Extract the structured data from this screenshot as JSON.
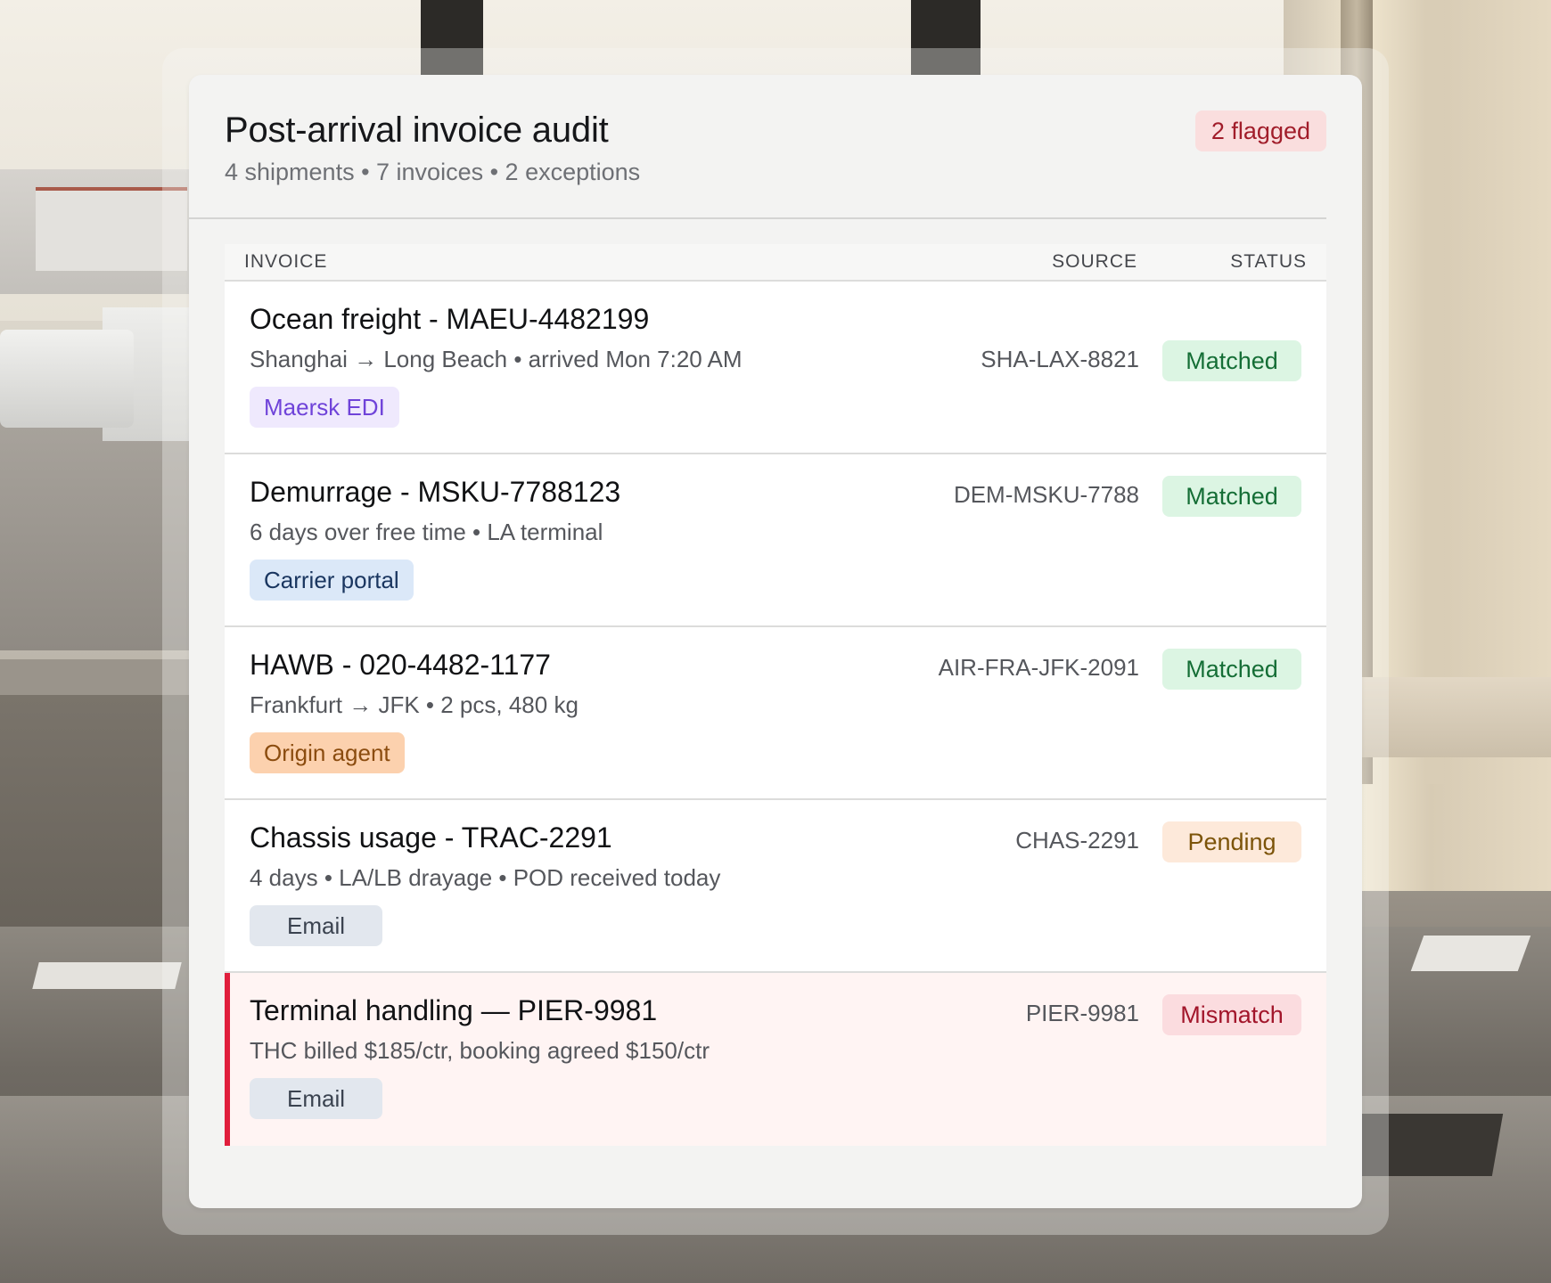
{
  "colors": {
    "accent_flag": "#e01e3c",
    "matched": "#156e36",
    "pending": "#7c5409",
    "mismatch": "#a2162b"
  },
  "audit": {
    "title": "Post-arrival invoice audit",
    "subtitle": "4 shipments • 7 invoices • 2 exceptions",
    "flag_badge": "2 flagged"
  },
  "table": {
    "headers": {
      "invoice": "INVOICE",
      "source": "SOURCE",
      "status": "STATUS"
    },
    "rows": [
      {
        "title": "Ocean freight - MAEU-4482199",
        "detail": "Shanghai → Long Beach • arrived Mon 7:20 AM",
        "chip": "Maersk EDI",
        "source": "SHA-LAX-8821",
        "status": "Matched"
      },
      {
        "title": "Demurrage - MSKU-7788123",
        "detail": "6 days over free time • LA terminal",
        "chip": "Carrier portal",
        "source": "DEM-MSKU-7788",
        "status": "Matched"
      },
      {
        "title": "HAWB - 020-4482-1177",
        "detail": "Frankfurt → JFK • 2 pcs, 480 kg",
        "chip": "Origin agent",
        "source": "AIR-FRA-JFK-2091",
        "status": "Matched"
      },
      {
        "title": "Chassis usage - TRAC-2291",
        "detail": "4 days • LA/LB drayage • POD received today",
        "chip": "Email",
        "source": "CHAS-2291",
        "status": "Pending"
      },
      {
        "title": "Terminal handling — PIER-9981",
        "detail": "THC billed $185/ctr, booking agreed $150/ctr",
        "chip": "Email",
        "source": "PIER-9981",
        "status": "Mismatch"
      }
    ]
  }
}
